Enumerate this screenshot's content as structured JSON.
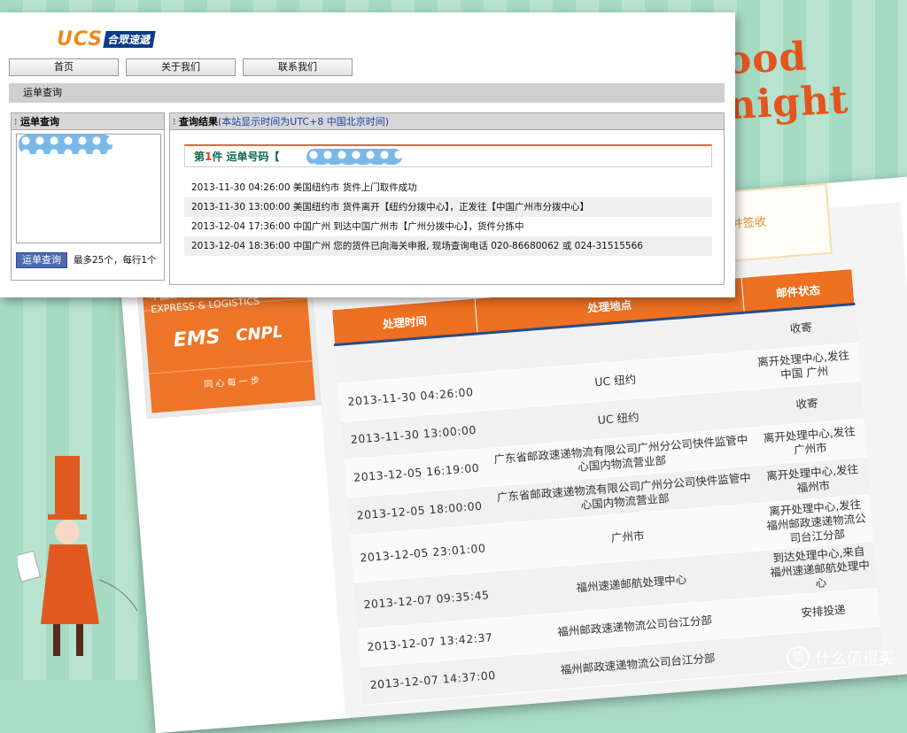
{
  "background": {
    "accent": "#a9dcc6",
    "greeting": "ood night"
  },
  "ucs": {
    "logo_text": "UCS",
    "logo_cn": "合眾速遞",
    "nav": [
      "首页",
      "关于我们",
      "联系我们"
    ],
    "breadcrumb": "运单查询",
    "left_panel": {
      "title": "运单查询",
      "button": "运单查询",
      "limit_note": "最多25个，每行1个"
    },
    "right_panel": {
      "title": "查询结果",
      "note": "(本站显示时间为UTC+8 中国北京时间)",
      "item_prefix": "第",
      "item_number": "1",
      "item_suffix": "件  运单号码【",
      "item_close": "】",
      "rows": [
        "2013-11-30 04:26:00 美国纽约市 货件上门取件成功",
        "2013-11-30 13:00:00 美国纽约市 货件离开【纽约分拨中心】，正发往【中国广州市分拨中心】",
        "2013-12-04 17:36:00 中国广州 到达中国广州市【广州分拨中心】，货件分拣中",
        "2013-12-04 18:36:00 中国广州 您的货件已向海关申报, 现场查询电话 020-86680062 或 024-31515566"
      ]
    }
  },
  "ems": {
    "status": "投递并签收",
    "logo": {
      "top": "中国邮政 CHINA POSTAL EXPRESS & LOGISTICS",
      "ems": "EMS",
      "cnpl": "CNPL",
      "slogan": "同 心 每 一 步"
    },
    "headers": [
      "处理时间",
      "处理地点",
      "邮件状态"
    ],
    "rows": [
      {
        "time": "",
        "place": "",
        "status": "收寄"
      },
      {
        "time": "2013-11-30    04:26:00",
        "place": "UC 纽约",
        "status": "离开处理中心,发往中国 广州"
      },
      {
        "time": "2013-11-30    13:00:00",
        "place": "UC 纽约",
        "status": "收寄"
      },
      {
        "time": "2013-12-05    16:19:00",
        "place": "广东省邮政速递物流有限公司广州分公司快件监管中心国内物流营业部",
        "status": "离开处理中心,发往广州市"
      },
      {
        "time": "2013-12-05    18:00:00",
        "place": "广东省邮政速递物流有限公司广州分公司快件监管中心国内物流营业部",
        "status": "离开处理中心,发往福州市"
      },
      {
        "time": "2013-12-05    23:01:00",
        "place": "广州市",
        "status": "离开处理中心,发往福州邮政速递物流公司台江分部"
      },
      {
        "time": "2013-12-07    09:35:45",
        "place": "福州速递邮航处理中心",
        "status": "到达处理中心,来自福州速递邮航处理中心"
      },
      {
        "time": "2013-12-07    13:42:37",
        "place": "福州邮政速递物流公司台江分部",
        "status": "安排投递"
      },
      {
        "time": "2013-12-07    14:37:00",
        "place": "福州邮政速递物流公司台江分部",
        "status": ""
      }
    ]
  },
  "watermark": {
    "icon": "值",
    "text": "什么值得买"
  }
}
